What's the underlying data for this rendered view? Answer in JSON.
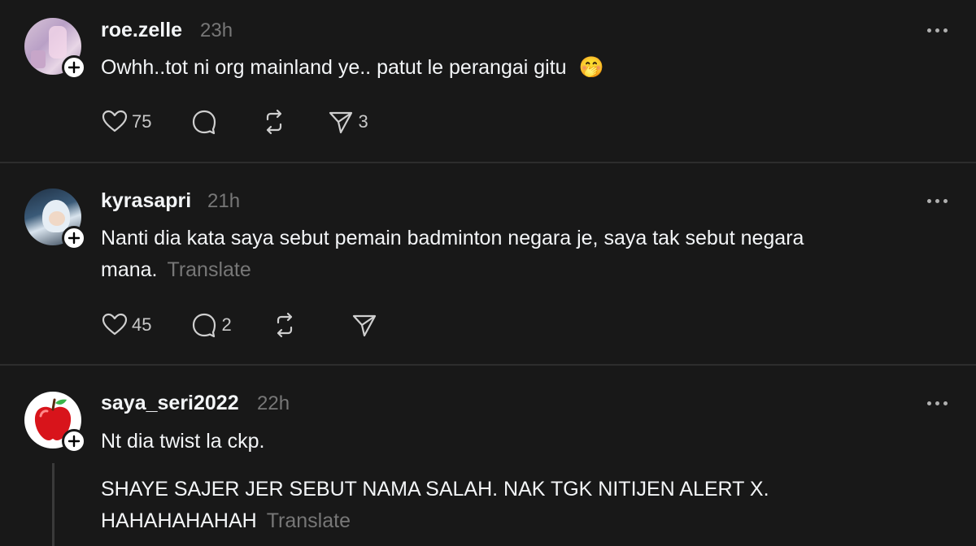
{
  "posts": [
    {
      "username": "roe.zelle",
      "time": "23h",
      "text": "Owhh..tot ni org mainland ye.. patut le perangai gitu",
      "emoji": "🤭",
      "likes": "75",
      "replies": "",
      "shares": "3"
    },
    {
      "username": "kyrasapri",
      "time": "21h",
      "text_line1": "Nanti dia kata saya sebut pemain badminton negara je, saya tak sebut negara",
      "text_line2": "mana.",
      "translate": "Translate",
      "likes": "45",
      "replies": "2",
      "shares": ""
    },
    {
      "username": "saya_seri2022",
      "time": "22h",
      "text": "Nt dia twist la ckp.",
      "text2_line1": "SHAYE SAJER JER SEBUT NAMA SALAH. NAK TGK NITIJEN ALERT X.",
      "text2_line2": "HAHAHAHAHAH",
      "translate": "Translate"
    }
  ],
  "icons": {
    "like": "heart-icon",
    "reply": "comment-icon",
    "repost": "repost-icon",
    "share": "send-icon",
    "follow": "plus-icon",
    "more": "more-dots-icon"
  }
}
